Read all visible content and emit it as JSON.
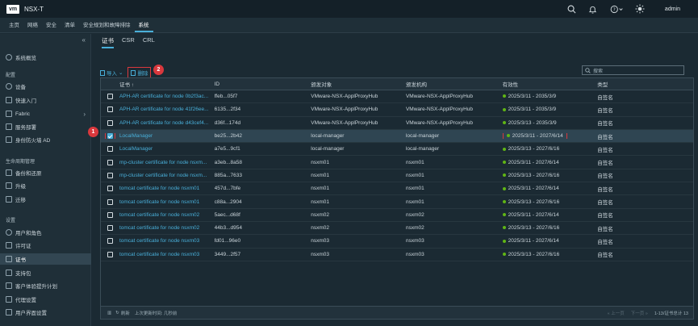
{
  "header": {
    "logo": "vm",
    "title": "NSX-T",
    "user": "admin"
  },
  "nav": {
    "items": [
      "主页",
      "网络",
      "安全",
      "清单",
      "安全规划和故障排除",
      "系统"
    ],
    "active_index": 5
  },
  "sidebar": {
    "items": [
      {
        "label": "系统概览",
        "icon": "overview-icon"
      },
      {
        "section": "配置"
      },
      {
        "label": "设备",
        "icon": "appliance-icon"
      },
      {
        "label": "快速入门",
        "icon": "quickstart-icon"
      },
      {
        "label": "Fabric",
        "icon": "fabric-icon",
        "expandable": true
      },
      {
        "label": "服务部署",
        "icon": "deploy-icon"
      },
      {
        "label": "身份防火墙 AD",
        "icon": "firewall-icon"
      },
      {
        "section": "生命周期管理"
      },
      {
        "label": "备份和还原",
        "icon": "backup-icon"
      },
      {
        "label": "升级",
        "icon": "upgrade-icon"
      },
      {
        "label": "迁移",
        "icon": "migrate-icon"
      },
      {
        "section": "设置"
      },
      {
        "label": "用户和角色",
        "icon": "users-icon"
      },
      {
        "label": "许可证",
        "icon": "license-icon"
      },
      {
        "label": "证书",
        "icon": "certificate-icon",
        "active": true
      },
      {
        "label": "支持包",
        "icon": "support-icon"
      },
      {
        "label": "客户体验提升计划",
        "icon": "ceip-icon"
      },
      {
        "label": "代理设置",
        "icon": "proxy-icon"
      },
      {
        "label": "用户界面设置",
        "icon": "ui-settings-icon"
      }
    ]
  },
  "tabs": [
    "证书",
    "CSR",
    "CRL"
  ],
  "toolbar": {
    "import": "导入",
    "delete": "删除"
  },
  "search": {
    "placeholder": "搜索"
  },
  "badges": {
    "one": "1",
    "two": "2"
  },
  "table": {
    "columns": [
      "证书",
      "ID",
      "颁发对象",
      "颁发机构",
      "有效性",
      "类型"
    ],
    "sort_indicator": "↑",
    "rows": [
      [
        "APH-AR certificate for node 0b2f3ac...",
        "ffeb...05f7",
        "VMware-NSX-ApplProxyHub",
        "VMware-NSX-ApplProxyHub",
        "2025/3/11 - 2035/3/9",
        "自签名"
      ],
      [
        "APH-AR certificate for node 41f26ee...",
        "6135...2f34",
        "VMware-NSX-ApplProxyHub",
        "VMware-NSX-ApplProxyHub",
        "2025/3/11 - 2035/3/9",
        "自签名"
      ],
      [
        "APH-AR certificate for node d43cef4...",
        "d36f...174d",
        "VMware-NSX-ApplProxyHub",
        "VMware-NSX-ApplProxyHub",
        "2025/3/13 - 2035/3/9",
        "自签名"
      ],
      [
        "LocalManager",
        "be25...2b42",
        "local-manager",
        "local-manager",
        "2025/3/11 - 2027/6/14",
        "自签名"
      ],
      [
        "LocalManager",
        "a7e5...9cf1",
        "local-manager",
        "local-manager",
        "2025/3/13 - 2027/6/16",
        "自签名"
      ],
      [
        "mp-cluster certificate for node nsxm...",
        "a3eb...8a58",
        "nsxm01",
        "nsxm01",
        "2025/3/11 - 2027/6/14",
        "自签名"
      ],
      [
        "mp-cluster certificate for node nsxm...",
        "885a...7633",
        "nsxm01",
        "nsxm01",
        "2025/3/13 - 2027/6/16",
        "自签名"
      ],
      [
        "tomcat certificate for node nsxm01",
        "457d...7bfe",
        "nsxm01",
        "nsxm01",
        "2025/3/11 - 2027/6/14",
        "自签名"
      ],
      [
        "tomcat certificate for node nsxm01",
        "c88a...2904",
        "nsxm01",
        "nsxm01",
        "2025/3/13 - 2027/6/16",
        "自签名"
      ],
      [
        "tomcat certificate for node nsxm02",
        "5aec...d68f",
        "nsxm02",
        "nsxm02",
        "2025/3/11 - 2027/6/14",
        "自签名"
      ],
      [
        "tomcat certificate for node nsxm02",
        "44b3...d954",
        "nsxm02",
        "nsxm02",
        "2025/3/13 - 2027/6/16",
        "自签名"
      ],
      [
        "tomcat certificate for node nsxm03",
        "fd01...96e0",
        "nsxm03",
        "nsxm03",
        "2025/3/11 - 2027/6/14",
        "自签名"
      ],
      [
        "tomcat certificate for node nsxm03",
        "3449...2f57",
        "nsxm03",
        "nsxm03",
        "2025/3/13 - 2027/6/16",
        "自签名"
      ]
    ],
    "selected_row": 3
  },
  "footer": {
    "refresh": "刷新",
    "updated": "上次更新时间: 几秒前",
    "prev": "上一页",
    "next": "下一页",
    "count": "1-13/证书总计 13"
  },
  "colors": {
    "accent": "#49afd9",
    "highlight": "#d9383d",
    "valid": "#60b515"
  }
}
